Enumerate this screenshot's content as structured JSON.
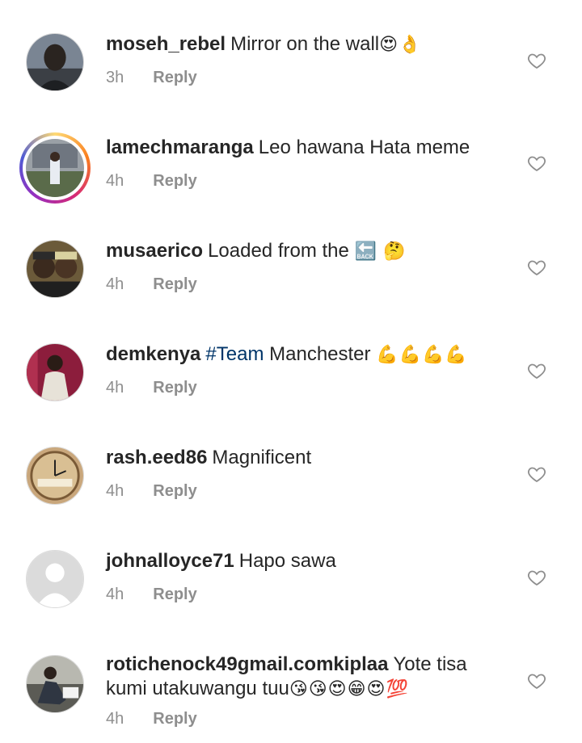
{
  "comments": [
    {
      "username": "moseh_rebel",
      "text": "Mirror on the wall",
      "emoji": "😍👌",
      "time": "3h",
      "reply": "Reply"
    },
    {
      "username": "lamechmaranga",
      "text": "Leo hawana Hata meme",
      "emoji": "",
      "time": "4h",
      "reply": "Reply"
    },
    {
      "username": "musaerico",
      "text": "Loaded from the",
      "emoji": "🔙 🤔",
      "time": "4h",
      "reply": "Reply"
    },
    {
      "username": "demkenya",
      "hashtag": "#Team",
      "text": "Manchester",
      "emoji": "💪💪💪💪",
      "time": "4h",
      "reply": "Reply"
    },
    {
      "username": "rash.eed86",
      "text": "Magnificent",
      "emoji": "",
      "time": "4h",
      "reply": "Reply"
    },
    {
      "username": "johnalloyce71",
      "text": "Hapo sawa",
      "emoji": "",
      "time": "4h",
      "reply": "Reply"
    },
    {
      "username": "rotichenock49gmail.comkiplaa",
      "text": "Yote tisa kumi utakuwangu tuu",
      "emoji": "😘😘😍😁😍💯",
      "time": "4h",
      "reply": "Reply"
    }
  ],
  "colors": {
    "hashtag": "#003569",
    "muted": "#8e8e8e",
    "text": "#262626"
  },
  "icons": {
    "like": "heart-outline-icon"
  }
}
